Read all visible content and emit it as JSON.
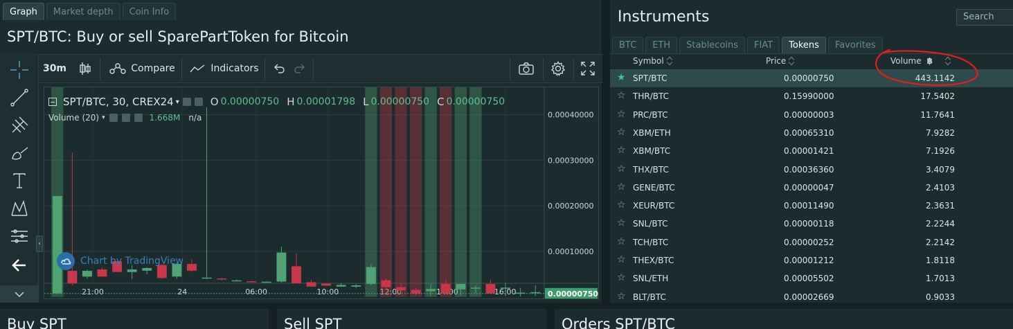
{
  "chart_panel": {
    "tabs": [
      {
        "label": "Graph",
        "active": true
      },
      {
        "label": "Market depth",
        "active": false
      },
      {
        "label": "Coin Info",
        "active": false
      }
    ],
    "title": "SPT/BTC: Buy or sell SparePartToken for Bitcoin",
    "toolbar": {
      "interval": "30m",
      "compare_label": "Compare",
      "indicators_label": "Indicators"
    },
    "legend": {
      "symbol_line": "SPT/BTC, 30, CREX24",
      "open_key": "O",
      "open": "0.00000750",
      "high_key": "H",
      "high": "0.00001798",
      "low_key": "L",
      "low": "0.00000750",
      "close_key": "C",
      "close": "0.00000750",
      "volume_label": "Volume (20)",
      "volume_value": "1.668M",
      "volume_extra": "n/a"
    },
    "watermark": "Chart by TradingView"
  },
  "chart_data": {
    "type": "candlestick",
    "x_ticks": [
      "21:00",
      "24",
      "06:00",
      "10:00",
      "12:00",
      "14:00",
      "16:00"
    ],
    "y_ticks": [
      "0.00040000",
      "0.00030000",
      "0.00020000",
      "0.00010000"
    ],
    "y_tick_values": [
      0.0004,
      0.0003,
      0.0002,
      0.0001
    ],
    "last_price_label": "0.00000750",
    "last_price": 7.5e-06,
    "ylim": [
      -3.5e-06,
      0.00046
    ],
    "colors": {
      "up": "#4fa374",
      "down": "#c8374a",
      "last_price_bg": "#3c9e6b"
    },
    "candles": [
      {
        "o": 8e-06,
        "h": 0.000221,
        "l": 6e-06,
        "c": 0.000221,
        "vol": 0.018
      },
      {
        "o": 5.7e-05,
        "h": 0.000317,
        "l": 2.5e-05,
        "c": 3e-05,
        "vol": 0.0
      },
      {
        "o": 4.5e-05,
        "h": 6e-05,
        "l": 4e-05,
        "c": 5.7e-05,
        "vol": 0.0
      },
      {
        "o": 6e-05,
        "h": 6.5e-05,
        "l": 4.5e-05,
        "c": 4.5e-05,
        "vol": 0.0
      },
      {
        "o": 7.8e-05,
        "h": 7.8e-05,
        "l": 5.5e-05,
        "c": 5.5e-05,
        "vol": 0.0
      },
      {
        "o": 5.5e-05,
        "h": 7e-05,
        "l": 4e-05,
        "c": 6e-05,
        "vol": 0.0
      },
      {
        "o": 5.8e-05,
        "h": 6.5e-05,
        "l": 5e-05,
        "c": 6.3e-05,
        "vol": 0.0
      },
      {
        "o": 7e-05,
        "h": 7.2e-05,
        "l": 4e-05,
        "c": 4.2e-05,
        "vol": 0.0
      },
      {
        "o": 4.5e-05,
        "h": 7.5e-05,
        "l": 4e-05,
        "c": 7.2e-05,
        "vol": 0.0
      },
      {
        "o": 7.2e-05,
        "h": 8.2e-05,
        "l": 5.5e-05,
        "c": 5.8e-05,
        "vol": 0.0
      },
      {
        "o": 4.2e-05,
        "h": 0.000416,
        "l": 4e-05,
        "c": 4.2e-05,
        "vol": 0.0
      },
      {
        "o": 4e-05,
        "h": 4.2e-05,
        "l": 3.6e-05,
        "c": 3.9e-05,
        "vol": 0.0
      },
      {
        "o": 3.6e-05,
        "h": 3.8e-05,
        "l": 3.4e-05,
        "c": 3.6e-05,
        "vol": 0.0
      },
      {
        "o": 3.4e-05,
        "h": 3.5e-05,
        "l": 3.1e-05,
        "c": 3.3e-05,
        "vol": 0.0
      },
      {
        "o": 3.3e-05,
        "h": 3.4e-05,
        "l": 3.1e-05,
        "c": 3.3e-05,
        "vol": 0.0
      },
      {
        "o": 3.4e-05,
        "h": 0.00011,
        "l": 3.1e-05,
        "c": 9.7e-05,
        "vol": 0.0
      },
      {
        "o": 6.7e-05,
        "h": 9.5e-05,
        "l": 3e-05,
        "c": 3e-05,
        "vol": 0.0
      },
      {
        "o": 3.2e-05,
        "h": 3.8e-05,
        "l": 2.5e-05,
        "c": 2.3e-05,
        "vol": 0.0
      },
      {
        "o": 2.9e-05,
        "h": 3e-05,
        "l": 2.5e-05,
        "c": 2.5e-05,
        "vol": 0.0
      },
      {
        "o": 2.3e-05,
        "h": 3e-05,
        "l": 2.2e-05,
        "c": 2.6e-05,
        "vol": 0.0
      },
      {
        "o": 2.3e-05,
        "h": 2.8e-05,
        "l": 2e-05,
        "c": 2.5e-05,
        "vol": 0.0
      },
      {
        "o": 2.9e-05,
        "h": 7.2e-05,
        "l": 2.5e-05,
        "c": 6.5e-05,
        "vol": 0.003
      },
      {
        "o": 3.6e-05,
        "h": 4e-05,
        "l": 1.6e-05,
        "c": 2.2e-05,
        "vol": 0.007
      },
      {
        "o": 2.1e-05,
        "h": 3e-05,
        "l": 1e-05,
        "c": 1.5e-05,
        "vol": 0.012
      },
      {
        "o": 1.5e-05,
        "h": 2e-05,
        "l": 5e-06,
        "c": 8e-06,
        "vol": 0.004
      },
      {
        "o": 1.3e-05,
        "h": 2.8e-05,
        "l": 3e-06,
        "c": 1.7e-05,
        "vol": 0.009
      },
      {
        "o": 2.8e-05,
        "h": 3.9e-05,
        "l": 8e-06,
        "c": 8e-06,
        "vol": 0.009
      },
      {
        "o": 1.7e-05,
        "h": 2.8e-05,
        "l": 3e-06,
        "c": 2.8e-05,
        "vol": 0.012
      },
      {
        "o": 1.9e-05,
        "h": 2.5e-05,
        "l": 8e-06,
        "c": 2e-05,
        "vol": 0.018
      },
      {
        "o": 2.8e-05,
        "h": 3.8e-05,
        "l": 8e-06,
        "c": 8e-06,
        "vol": 0.0
      },
      {
        "o": 2e-05,
        "h": 3.2e-05,
        "l": 2e-06,
        "c": 2e-05,
        "vol": 0.0
      },
      {
        "o": 9e-06,
        "h": 2e-05,
        "l": 1e-06,
        "c": 9e-06,
        "vol": 0.0
      },
      {
        "o": 1e-05,
        "h": 2.5e-05,
        "l": 2e-06,
        "c": 1e-05,
        "vol": 0.0
      }
    ]
  },
  "instruments": {
    "title": "Instruments",
    "search_placeholder": "Search",
    "tabs": [
      {
        "label": "BTC",
        "active": false
      },
      {
        "label": "ETH",
        "active": false
      },
      {
        "label": "Stablecoins",
        "active": false
      },
      {
        "label": "FIAT",
        "active": false
      },
      {
        "label": "Tokens",
        "active": true
      },
      {
        "label": "Favorites",
        "active": false
      }
    ],
    "columns": {
      "symbol": "Symbol",
      "price": "Price",
      "volume": "Volume",
      "volume_currency": "฿"
    },
    "rows": [
      {
        "symbol": "SPT/BTC",
        "price": "0.00000750",
        "volume": "443.1142",
        "favorite": true
      },
      {
        "symbol": "THR/BTC",
        "price": "0.15990000",
        "volume": "17.5402",
        "favorite": false
      },
      {
        "symbol": "PRC/BTC",
        "price": "0.00000003",
        "volume": "11.7641",
        "favorite": false
      },
      {
        "symbol": "XBM/ETH",
        "price": "0.00065310",
        "volume": "7.9282",
        "favorite": false
      },
      {
        "symbol": "XBM/BTC",
        "price": "0.00001421",
        "volume": "7.1926",
        "favorite": false
      },
      {
        "symbol": "THX/BTC",
        "price": "0.00036360",
        "volume": "3.4079",
        "favorite": false
      },
      {
        "symbol": "GENE/BTC",
        "price": "0.00000047",
        "volume": "2.4103",
        "favorite": false
      },
      {
        "symbol": "XEUR/BTC",
        "price": "0.00011490",
        "volume": "2.3631",
        "favorite": false
      },
      {
        "symbol": "SNL/BTC",
        "price": "0.00000118",
        "volume": "2.2244",
        "favorite": false
      },
      {
        "symbol": "TCH/BTC",
        "price": "0.00000252",
        "volume": "2.2142",
        "favorite": false
      },
      {
        "symbol": "THEX/BTC",
        "price": "0.00001212",
        "volume": "1.8118",
        "favorite": false
      },
      {
        "symbol": "SNL/ETH",
        "price": "0.00005502",
        "volume": "1.7013",
        "favorite": false
      },
      {
        "symbol": "BLT/BTC",
        "price": "0.00002669",
        "volume": "0.9033",
        "favorite": false
      }
    ]
  },
  "bottom_panels": {
    "buy_title": "Buy SPT",
    "sell_title": "Sell SPT",
    "orders_title": "Orders SPT/BTC"
  },
  "colors": {
    "background": "#152022",
    "panel": "#1c2b2d",
    "up": "#4fa374",
    "down": "#c8374a",
    "selected_row": "#2f4a4d",
    "annotation_red": "#e01e1e"
  }
}
